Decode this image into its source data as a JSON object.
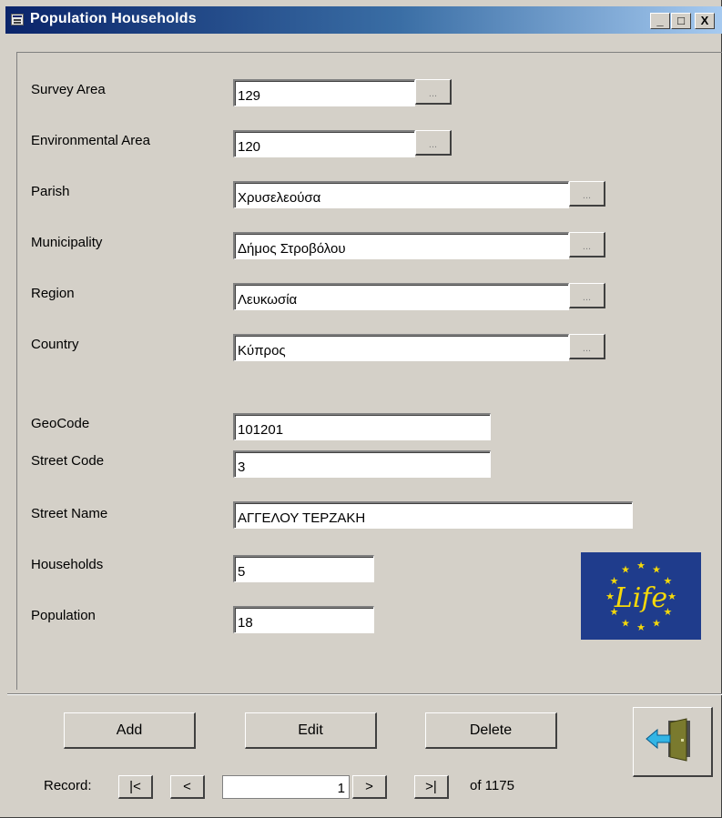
{
  "window": {
    "title": "Population Households",
    "controls": {
      "minimize": "_",
      "maximize": "□",
      "close": "X"
    }
  },
  "form": {
    "survey_area": {
      "label": "Survey Area",
      "value": "129"
    },
    "environmental_area": {
      "label": "Environmental Area",
      "value": "120"
    },
    "parish": {
      "label": "Parish",
      "value": "Χρυσελεούσα"
    },
    "municipality": {
      "label": "Municipality",
      "value": "Δήμος Στροβόλου"
    },
    "region": {
      "label": "Region",
      "value": "Λευκωσία"
    },
    "country": {
      "label": "Country",
      "value": "Κύπρος"
    },
    "geocode": {
      "label": "GeoCode",
      "value": "101201"
    },
    "street_code": {
      "label": "Street Code",
      "value": "3"
    },
    "street_name": {
      "label": "Street Name",
      "value": "ΑΓΓΕΛΟΥ ΤΕΡΖΑΚΗ"
    },
    "households": {
      "label": "Households",
      "value": "5"
    },
    "population": {
      "label": "Population",
      "value": "18"
    },
    "lookup_button": "..."
  },
  "logo": {
    "text": "Life",
    "background": "#1f3c8c",
    "star_color": "#f5d90a"
  },
  "buttons": {
    "add": "Add",
    "edit": "Edit",
    "delete": "Delete",
    "exit_icon": "exit-door-icon"
  },
  "navigator": {
    "label": "Record:",
    "first": "|<",
    "prev": "<",
    "current": "1",
    "next": ">",
    "last": ">|",
    "total": "of 1175"
  }
}
